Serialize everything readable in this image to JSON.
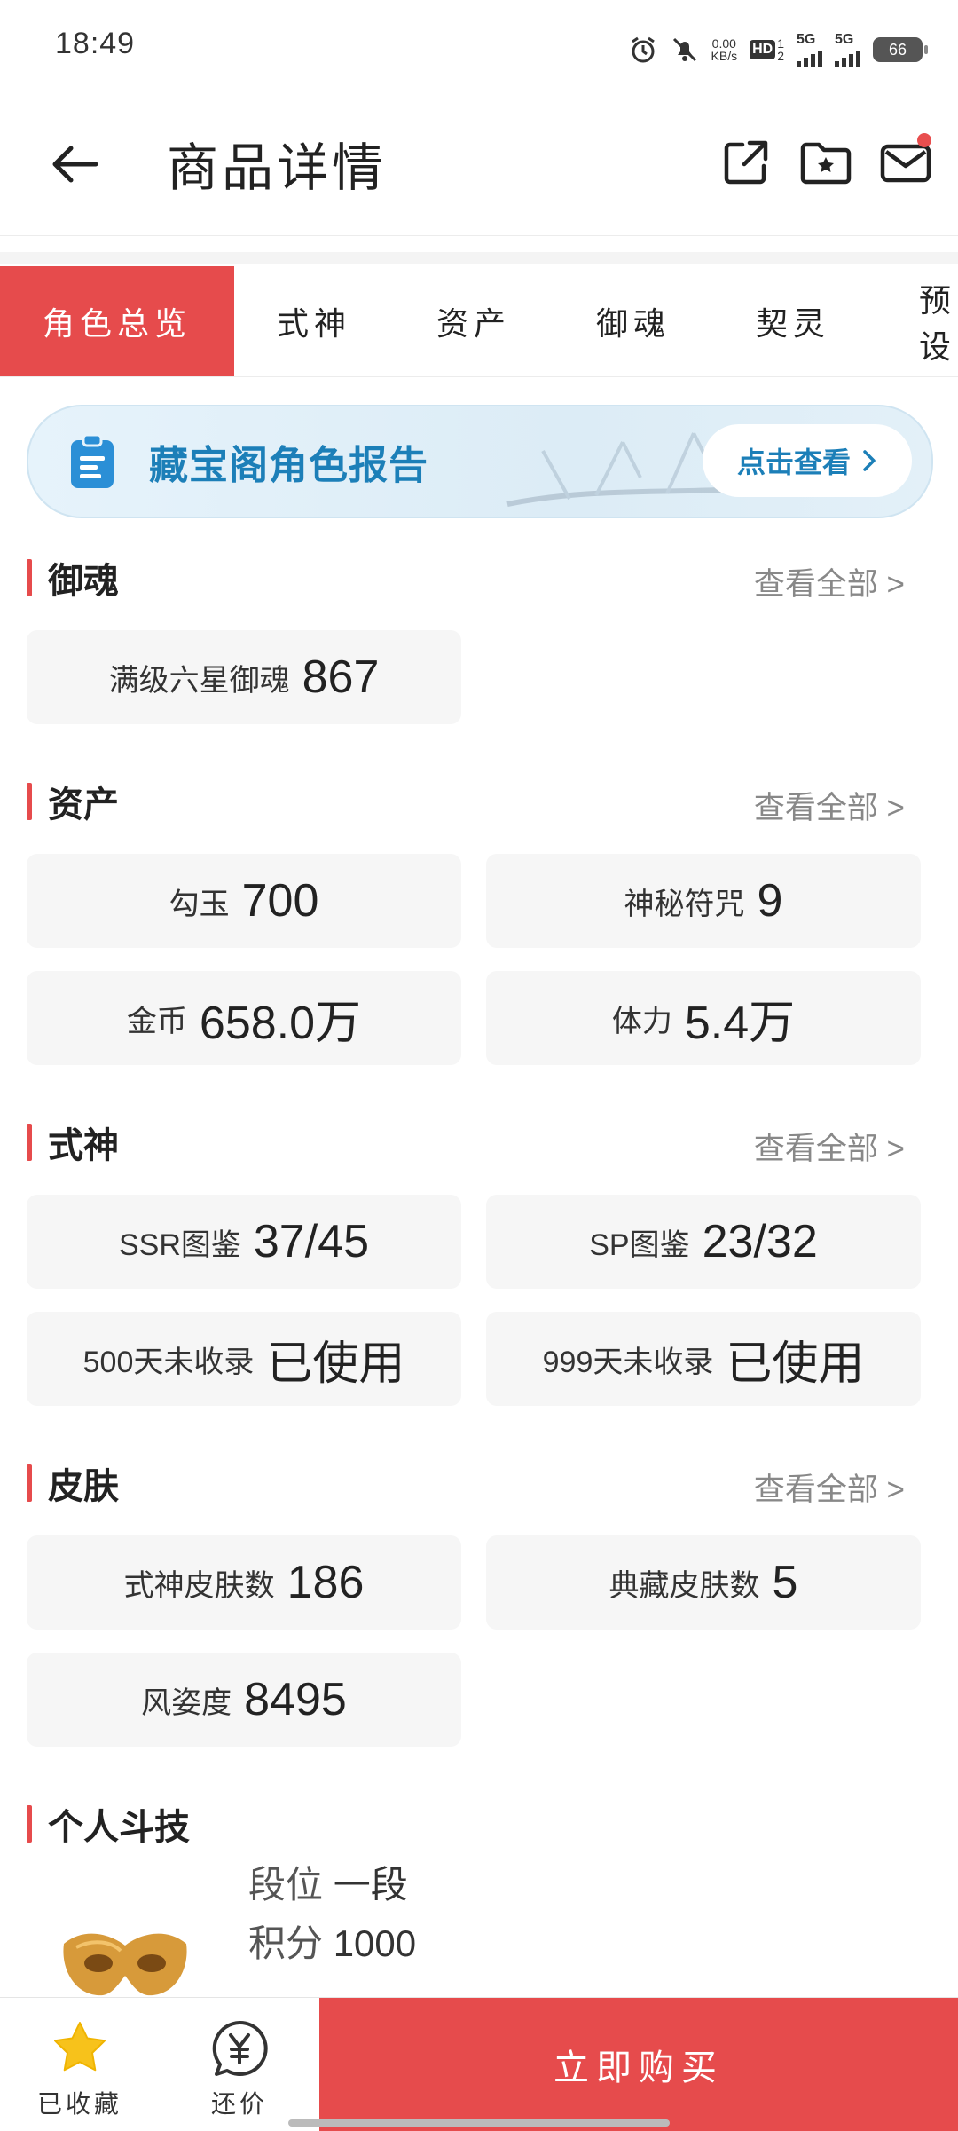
{
  "status": {
    "time": "18:49",
    "net_speed_top": "0.00",
    "net_speed_unit": "KB/s",
    "hd": "HD",
    "hd_sub_top": "1",
    "hd_sub_bottom": "2",
    "sig1": "5G",
    "sig2": "5G",
    "battery": "66"
  },
  "header": {
    "title": "商品详情"
  },
  "tabs": [
    {
      "label": "角色总览",
      "active": true
    },
    {
      "label": "式神"
    },
    {
      "label": "资产"
    },
    {
      "label": "御魂"
    },
    {
      "label": "契灵"
    },
    {
      "label": "预设"
    }
  ],
  "banner": {
    "title": "藏宝阁角色报告",
    "button": "点击查看"
  },
  "sections": {
    "yuhun": {
      "title": "御魂",
      "see_all": "查看全部 >",
      "cards": [
        {
          "label": "满级六星御魂",
          "value": "867"
        }
      ]
    },
    "assets": {
      "title": "资产",
      "see_all": "查看全部 >",
      "cards": [
        {
          "label": "勾玉",
          "value": "700"
        },
        {
          "label": "神秘符咒",
          "value": "9"
        },
        {
          "label": "金币",
          "value": "658.0万"
        },
        {
          "label": "体力",
          "value": "5.4万"
        }
      ]
    },
    "shikigami": {
      "title": "式神",
      "see_all": "查看全部 >",
      "cards": [
        {
          "label": "SSR图鉴",
          "value": "37/45"
        },
        {
          "label": "SP图鉴",
          "value": "23/32"
        },
        {
          "label": "500天未收录",
          "value": "已使用"
        },
        {
          "label": "999天未收录",
          "value": "已使用"
        }
      ]
    },
    "skins": {
      "title": "皮肤",
      "see_all": "查看全部 >",
      "cards": [
        {
          "label": "式神皮肤数",
          "value": "186"
        },
        {
          "label": "典藏皮肤数",
          "value": "5"
        },
        {
          "label": "风姿度",
          "value": "8495"
        }
      ]
    },
    "pvp": {
      "title": "个人斗技",
      "rank_label": "段位",
      "rank_value": "一段",
      "score_label": "积分",
      "score_value": "1000"
    }
  },
  "bottom": {
    "favorite": "已收藏",
    "bargain": "还价",
    "buy": "立即购买"
  },
  "colors": {
    "accent": "#e64b4c",
    "banner_text": "#1c7fb8"
  }
}
